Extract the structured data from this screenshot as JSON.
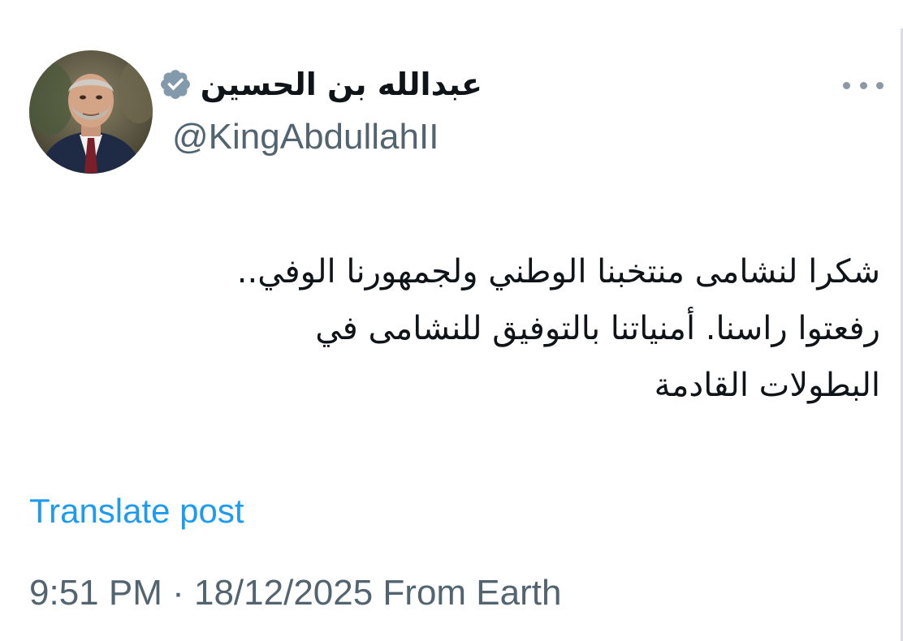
{
  "author": {
    "display_name": "عبدالله بن الحسين",
    "handle": "@KingAbdullahII",
    "verified_icon": "verified-badge-icon",
    "avatar_icon": "profile-photo"
  },
  "menu": {
    "icon": "more-options-icon"
  },
  "tweet": {
    "lines": [
      "شكرا لنشامى منتخبنا الوطني ولجمهورنا الوفي..",
      "رفعتوا راسنا. أمنياتنا بالتوفيق للنشامى في",
      "البطولات القادمة"
    ]
  },
  "translate_label": "Translate post",
  "meta": {
    "time": "9:51 PM",
    "separator": " · ",
    "date": "18/12/2025",
    "source": " From Earth"
  },
  "colors": {
    "text_primary": "#0f1419",
    "text_secondary": "#536471",
    "link": "#1d9bf0",
    "verified_badge": "#829aab"
  }
}
